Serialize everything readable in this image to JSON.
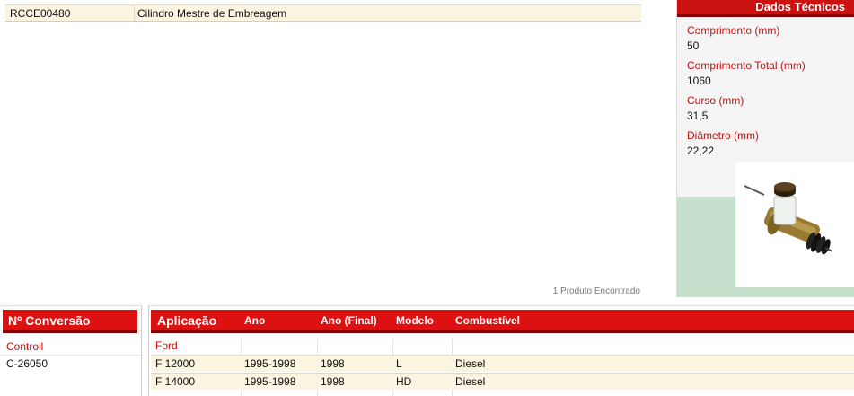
{
  "results": {
    "rows": [
      {
        "code": "RCCE00480",
        "description": "Cilindro Mestre de Embreagem"
      }
    ],
    "found_text": "1 Produto Encontrado"
  },
  "tech": {
    "title": "Dados Técnicos",
    "specs": [
      {
        "label": "Comprimento (mm)",
        "value": "50"
      },
      {
        "label": "Comprimento Total (mm)",
        "value": "1060"
      },
      {
        "label": "Curso (mm)",
        "value": "31,5"
      },
      {
        "label": "Diâmetro (mm)",
        "value": "22,22"
      }
    ]
  },
  "conversion": {
    "title": "Nº Conversão",
    "brand": "Controil",
    "code": "C-26050"
  },
  "application": {
    "title": "Aplicação",
    "columns": [
      "Ano",
      "Ano (Final)",
      "Modelo",
      "Combustível"
    ],
    "brand": "Ford",
    "rows": [
      {
        "vehicle": "F 12000",
        "year": "1995-1998",
        "year_final": "1998",
        "model": "L",
        "fuel": "Diesel"
      },
      {
        "vehicle": "F 14000",
        "year": "1995-1998",
        "year_final": "1998",
        "model": "HD",
        "fuel": "Diesel"
      }
    ]
  },
  "colors": {
    "header_red": "#dd1111",
    "label_red": "#c01010",
    "row_cream": "#fbf4e0",
    "panel_green": "#c6e0cd"
  }
}
